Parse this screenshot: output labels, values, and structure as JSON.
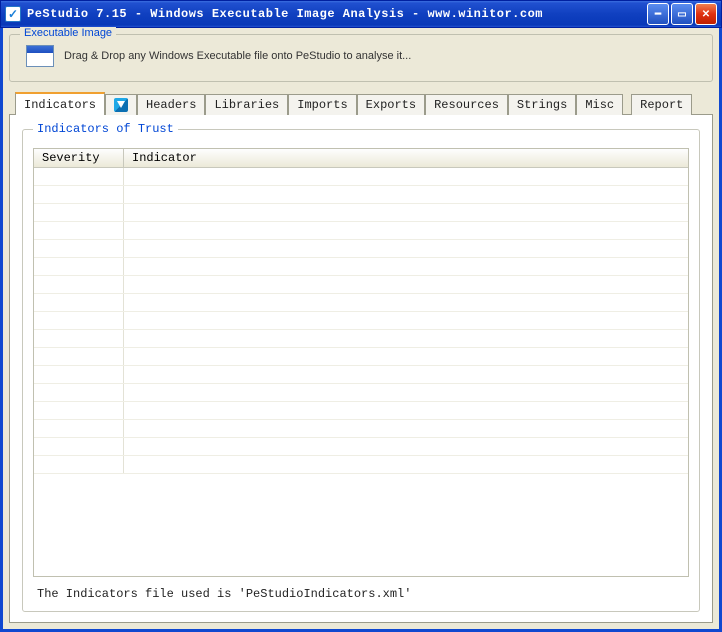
{
  "window": {
    "title": "PeStudio 7.15 - Windows Executable Image Analysis - www.winitor.com"
  },
  "executable_image": {
    "legend": "Executable Image",
    "hint": "Drag & Drop any Windows Executable file onto PeStudio to analyse it..."
  },
  "tabs": [
    {
      "label": "Indicators",
      "active": true
    },
    {
      "label": "",
      "icon": "vt"
    },
    {
      "label": "Headers"
    },
    {
      "label": "Libraries"
    },
    {
      "label": "Imports"
    },
    {
      "label": "Exports"
    },
    {
      "label": "Resources"
    },
    {
      "label": "Strings"
    },
    {
      "label": "Misc"
    },
    {
      "label": "Report"
    }
  ],
  "indicators_panel": {
    "legend": "Indicators of Trust",
    "columns": {
      "severity": "Severity",
      "indicator": "Indicator"
    },
    "rows": [],
    "footnote": "The Indicators file used is 'PeStudioIndicators.xml'"
  }
}
